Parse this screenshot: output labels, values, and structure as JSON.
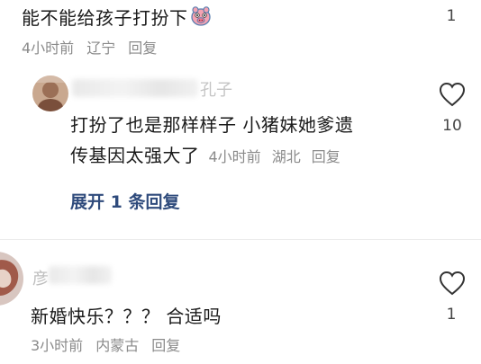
{
  "comment1": {
    "text": "能不能给孩子打扮下",
    "emoji_icon": "pig-face-emoji",
    "time": "4小时前",
    "location": "辽宁",
    "reply_label": "回复",
    "like_count": "1"
  },
  "reply1": {
    "username_fragment": "孔子",
    "text_line1": "打扮了也是那样样子 小猪妹她爹遗",
    "text_line2": "传基因太强大了",
    "time": "4小时前",
    "location": "湖北",
    "reply_label": "回复",
    "like_count": "10"
  },
  "expand_replies": {
    "label": "展开 1 条回复"
  },
  "comment2": {
    "username_fragment": "彦",
    "text": "新婚快乐？？？ 合适吗",
    "time": "3小时前",
    "location": "内蒙古",
    "reply_label": "回复",
    "like_count": "1"
  },
  "colors": {
    "text": "#1a1a1a",
    "meta": "#8a8a8a",
    "link": "#2f4b7c"
  }
}
